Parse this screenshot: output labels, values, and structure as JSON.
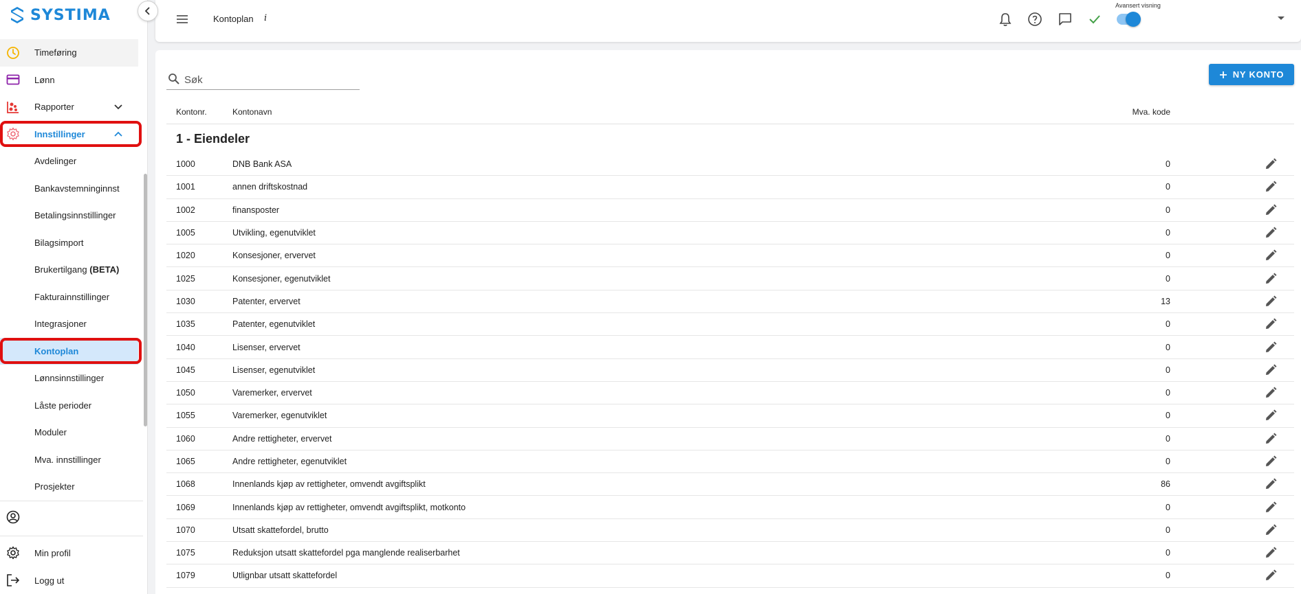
{
  "app": {
    "logo_text": "SYSTIMA"
  },
  "sidebar": {
    "items": [
      {
        "label": "Timeføring",
        "icon": "clock-icon"
      },
      {
        "label": "Lønn",
        "icon": "payment-card-icon"
      },
      {
        "label": "Rapporter",
        "icon": "report-chart-icon"
      },
      {
        "label": "Innstillinger",
        "icon": "settings-gear-icon"
      }
    ],
    "sub_items": [
      {
        "label": "Avdelinger"
      },
      {
        "label": "Bankavstemninginnst"
      },
      {
        "label": "Betalingsinnstillinger"
      },
      {
        "label": "Bilagsimport"
      },
      {
        "label": "Brukertilgang",
        "suffix": "(BETA)"
      },
      {
        "label": "Fakturainnstillinger"
      },
      {
        "label": "Integrasjoner"
      },
      {
        "label": "Kontoplan"
      },
      {
        "label": "Lønnsinnstillinger"
      },
      {
        "label": "Låste perioder"
      },
      {
        "label": "Moduler"
      },
      {
        "label": "Mva. innstillinger"
      },
      {
        "label": "Prosjekter"
      }
    ],
    "bottom": {
      "profile_label": "Min profil",
      "logout_label": "Logg ut"
    },
    "highlight_color": "#e01010"
  },
  "topbar": {
    "title": "Kontoplan",
    "info_glyph": "i",
    "advanced_view_label": "Avansert visning",
    "advanced_view_on": true
  },
  "main": {
    "search_placeholder": "Søk",
    "new_button_label": "NY KONTO",
    "columns": {
      "nr": "Kontonr.",
      "name": "Kontonavn",
      "mva": "Mva. kode"
    },
    "group_title": "1 - Eiendeler",
    "rows": [
      {
        "nr": "1000",
        "name": "DNB Bank ASA",
        "mva": "0"
      },
      {
        "nr": "1001",
        "name": "annen driftskostnad",
        "mva": "0"
      },
      {
        "nr": "1002",
        "name": "finansposter",
        "mva": "0"
      },
      {
        "nr": "1005",
        "name": "Utvikling, egenutviklet",
        "mva": "0"
      },
      {
        "nr": "1020",
        "name": "Konsesjoner, ervervet",
        "mva": "0"
      },
      {
        "nr": "1025",
        "name": "Konsesjoner, egenutviklet",
        "mva": "0"
      },
      {
        "nr": "1030",
        "name": "Patenter, ervervet",
        "mva": "13"
      },
      {
        "nr": "1035",
        "name": "Patenter, egenutviklet",
        "mva": "0"
      },
      {
        "nr": "1040",
        "name": "Lisenser, ervervet",
        "mva": "0"
      },
      {
        "nr": "1045",
        "name": "Lisenser, egenutviklet",
        "mva": "0"
      },
      {
        "nr": "1050",
        "name": "Varemerker, ervervet",
        "mva": "0"
      },
      {
        "nr": "1055",
        "name": "Varemerker, egenutviklet",
        "mva": "0"
      },
      {
        "nr": "1060",
        "name": "Andre rettigheter, ervervet",
        "mva": "0"
      },
      {
        "nr": "1065",
        "name": "Andre rettigheter, egenutviklet",
        "mva": "0"
      },
      {
        "nr": "1068",
        "name": "Innenlands kjøp av rettigheter, omvendt avgiftsplikt",
        "mva": "86"
      },
      {
        "nr": "1069",
        "name": "Innenlands kjøp av rettigheter, omvendt avgiftsplikt, motkonto",
        "mva": "0"
      },
      {
        "nr": "1070",
        "name": "Utsatt skattefordel, brutto",
        "mva": "0"
      },
      {
        "nr": "1075",
        "name": "Reduksjon utsatt skattefordel pga manglende realiserbarhet",
        "mva": "0"
      },
      {
        "nr": "1079",
        "name": "Utlignbar utsatt skattefordel",
        "mva": "0"
      }
    ]
  },
  "colors": {
    "accent": "#1e88d8",
    "active_bg": "#d4e8fb",
    "check_green": "#43a047",
    "clock_yellow": "#f5b400",
    "lonn_purple": "#8e24aa",
    "rapporter_red": "#e53935",
    "settings_pink": "#ef6f7b"
  }
}
